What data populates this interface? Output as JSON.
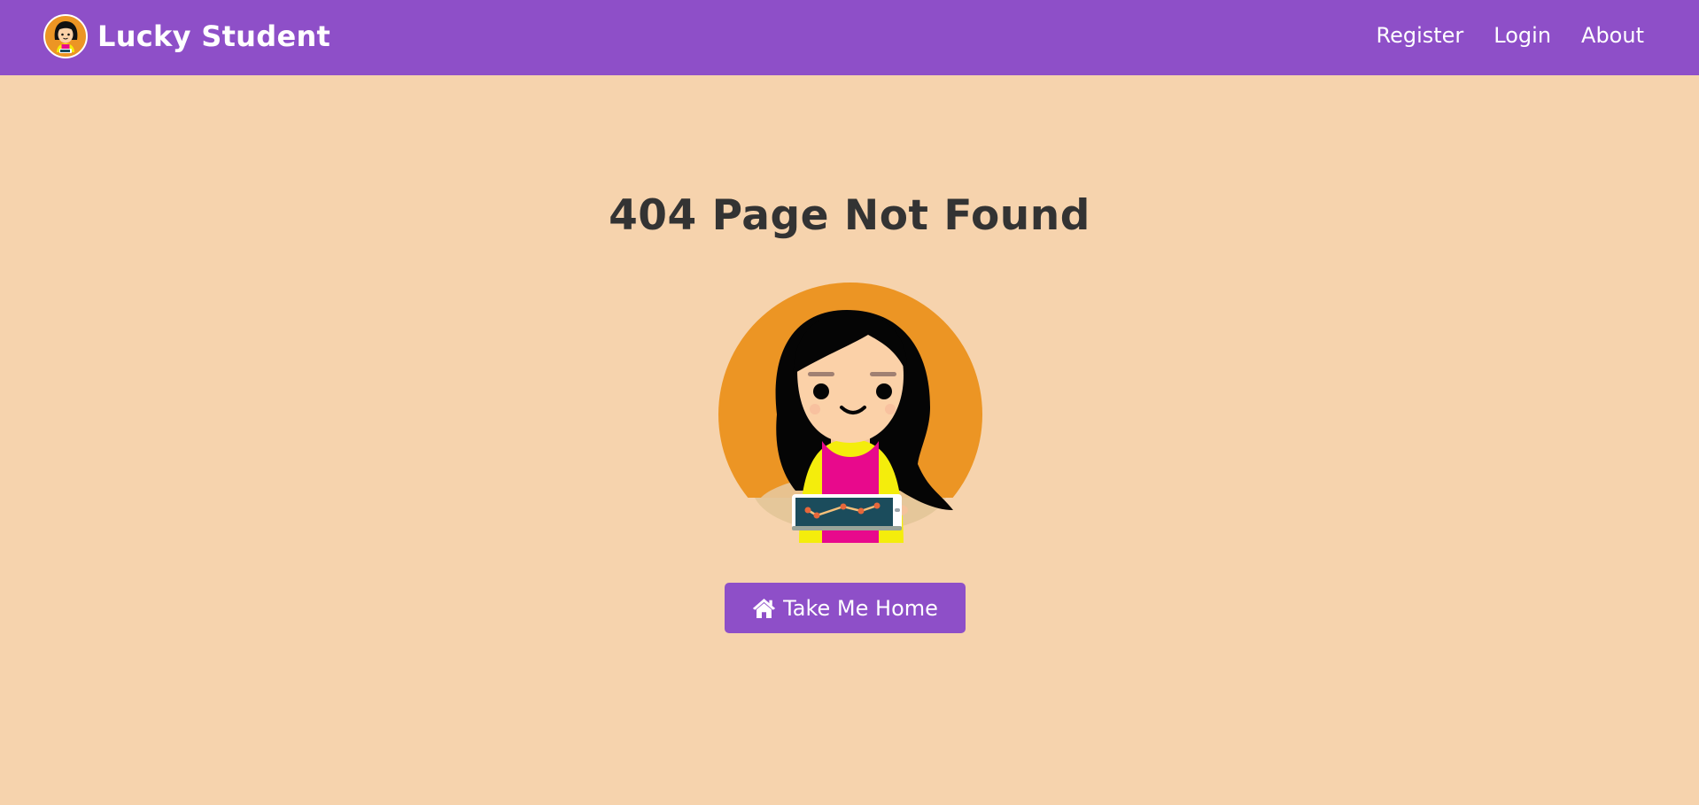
{
  "navbar": {
    "brand": "Lucky Student",
    "links": [
      "Register",
      "Login",
      "About"
    ],
    "background": "#8e4fc8"
  },
  "main": {
    "title": "404 Page Not Found",
    "illustration": "girl-with-tablet-avatar",
    "button": {
      "label": "Take Me Home",
      "icon": "home-icon"
    }
  },
  "colors": {
    "page_background": "#f6d3ad",
    "accent": "#8e4fc8",
    "title_text": "#333333",
    "avatar_circle": "#ec9524"
  }
}
